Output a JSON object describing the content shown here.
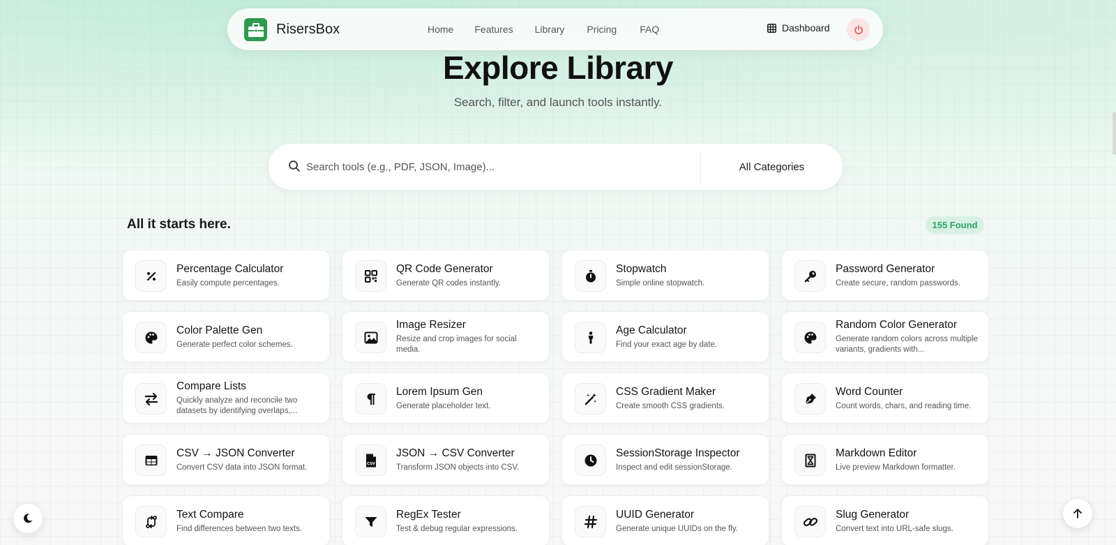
{
  "nav": {
    "brand": "RisersBox",
    "links": [
      "Home",
      "Features",
      "Library",
      "Pricing",
      "FAQ"
    ],
    "dashboard_label": "Dashboard",
    "logo_icon": "toolbox-icon",
    "power_icon": "power-icon"
  },
  "hero": {
    "title": "Explore Library",
    "subtitle": "Search, filter, and launch tools instantly."
  },
  "search": {
    "placeholder": "Search tools (e.g., PDF, JSON, Image)...",
    "value": "",
    "category": "All Categories"
  },
  "section": {
    "title": "All it starts here.",
    "found": "155 Found"
  },
  "colors": {
    "accent_green": "#2aa46a",
    "badge_bg": "#d8f1e3",
    "power_bg": "#fbe4e4",
    "power_icon": "#e05a5a"
  },
  "tools": [
    {
      "name": "Percentage Calculator",
      "desc": "Easily compute percentages.",
      "icon": "percent-icon"
    },
    {
      "name": "QR Code Generator",
      "desc": "Generate QR codes instantly.",
      "icon": "qr-code-icon"
    },
    {
      "name": "Stopwatch",
      "desc": "Simple online stopwatch.",
      "icon": "stopwatch-icon"
    },
    {
      "name": "Password Generator",
      "desc": "Create secure, random passwords.",
      "icon": "key-icon"
    },
    {
      "name": "Color Palette Gen",
      "desc": "Generate perfect color schemes.",
      "icon": "palette-icon"
    },
    {
      "name": "Image Resizer",
      "desc": "Resize and crop images for social media.",
      "icon": "image-icon"
    },
    {
      "name": "Age Calculator",
      "desc": "Find your exact age by date.",
      "icon": "person-icon"
    },
    {
      "name": "Random Color Generator",
      "desc": "Generate random colors across multiple variants, gradients with...",
      "icon": "palette-icon"
    },
    {
      "name": "Compare Lists",
      "desc": "Quickly analyze and reconcile two datasets by identifying overlaps,...",
      "icon": "swap-arrows-icon"
    },
    {
      "name": "Lorem Ipsum Gen",
      "desc": "Generate placeholder text.",
      "icon": "pilcrow-icon"
    },
    {
      "name": "CSS Gradient Maker",
      "desc": "Create smooth CSS gradients.",
      "icon": "magic-wand-icon"
    },
    {
      "name": "Word Counter",
      "desc": "Count words, chars, and reading time.",
      "icon": "pen-nib-icon"
    },
    {
      "name": "CSV → JSON Converter",
      "desc": "Convert CSV data into JSON format.",
      "icon": "table-icon"
    },
    {
      "name": "JSON → CSV Converter",
      "desc": "Transform JSON objects into CSV.",
      "icon": "csv-file-icon"
    },
    {
      "name": "SessionStorage Inspector",
      "desc": "Inspect and edit sessionStorage.",
      "icon": "clock-icon"
    },
    {
      "name": "Markdown Editor",
      "desc": "Live preview Markdown formatter.",
      "icon": "hourglass-icon"
    },
    {
      "name": "Text Compare",
      "desc": "Find differences between two texts.",
      "icon": "compare-icon"
    },
    {
      "name": "RegEx Tester",
      "desc": "Test & debug regular expressions.",
      "icon": "filter-icon"
    },
    {
      "name": "UUID Generator",
      "desc": "Generate unique UUIDs on the fly.",
      "icon": "hash-icon"
    },
    {
      "name": "Slug Generator",
      "desc": "Convert text into URL-safe slugs.",
      "icon": "link-icon"
    }
  ],
  "floating": {
    "theme_toggle_icon": "moon-icon",
    "back_to_top_icon": "arrow-up-icon"
  }
}
